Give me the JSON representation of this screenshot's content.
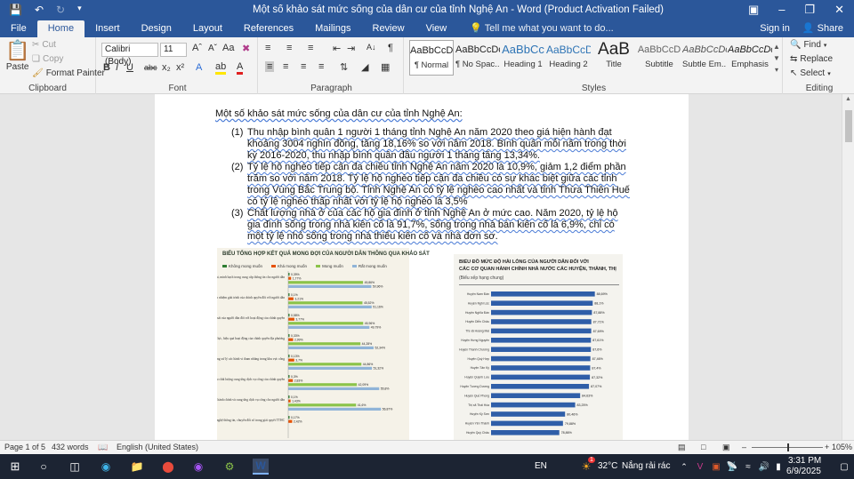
{
  "titlebar": {
    "title": "Một số khảo sát mức sống của dân cư của tỉnh Nghệ An - Word (Product Activation Failed)",
    "save_icon": "save-icon",
    "undo_icon": "undo-icon",
    "redo_icon": "redo-icon"
  },
  "tabs": [
    "File",
    "Home",
    "Insert",
    "Design",
    "Layout",
    "References",
    "Mailings",
    "Review",
    "View"
  ],
  "active_tab": "Home",
  "tellme": "Tell me what you want to do...",
  "signin": "Sign in",
  "share": "Share",
  "clipboard": {
    "paste": "Paste",
    "cut": "Cut",
    "copy": "Copy",
    "format_painter": "Format Painter",
    "label": "Clipboard"
  },
  "font": {
    "name": "Calibri (Body)",
    "size": "11",
    "label": "Font"
  },
  "paragraph": {
    "label": "Paragraph"
  },
  "styles": {
    "label": "Styles",
    "items": [
      {
        "sample": "AaBbCcDc",
        "name": "¶ Normal"
      },
      {
        "sample": "AaBbCcDc",
        "name": "¶ No Spac..."
      },
      {
        "sample": "AaBbCc",
        "name": "Heading 1"
      },
      {
        "sample": "AaBbCcD",
        "name": "Heading 2"
      },
      {
        "sample": "AaB",
        "name": "Title"
      },
      {
        "sample": "AaBbCcD",
        "name": "Subtitle"
      },
      {
        "sample": "AaBbCcDc",
        "name": "Subtle Em..."
      },
      {
        "sample": "AaBbCcDc",
        "name": "Emphasis"
      }
    ]
  },
  "editing": {
    "find": "Find",
    "replace": "Replace",
    "select": "Select",
    "label": "Editing"
  },
  "document": {
    "heading": "Một số khảo sát mức sống của dân cư của tỉnh Nghệ An:",
    "items": [
      {
        "num": "(1)",
        "text": "Thu nhập bình quân 1 người 1 tháng tỉnh Nghệ An năm 2020 theo giá hiện hành đạt khoảng 3004 nghìn đồng, tăng 18,16% so với năm 2018. Bình quân mỗi năm trong thời kỳ 2016-2020, thu nhập bình quân đầu người 1 tháng tăng 13,34%."
      },
      {
        "num": "(2)",
        "text": "Tỷ lệ hộ nghèo tiếp cận đa chiều tỉnh Nghệ An năm 2020 là 10,9%, giảm 1,2 điểm phần trăm so với năm 2018. Tỷ lệ hộ nghèo tiếp cận đa chiều có sự khác biệt giữa các tỉnh trong Vùng Bắc Trung bộ. Tỉnh Nghệ An có tỷ lệ nghèo cao nhất và tỉnh Thừa Thiên Huế có tỷ lệ nghèo thấp nhất với tỷ lệ hộ nghèo là 3,5%"
      },
      {
        "num": "(3)",
        "text": "Chất lượng nhà ở của các hộ gia đình ở tỉnh Nghệ An ở mức cao. Năm 2020, tỷ lệ hộ gia đình sống trong nhà kiên cố là 91,7%, sống trong nhà bán kiên cố là 6,9%, chỉ có một tỷ lệ nhỏ sống trong nhà thiếu kiên cố và nhà đơn sơ."
      }
    ]
  },
  "infographic_left": {
    "title": "BIỂU TỔNG HỢP KẾT QUẢ MONG ĐỢI CỦA NGƯỜI DÂN THÔNG QUA KHẢO SÁT",
    "legend": [
      "Không mong muốn",
      "Khá mong muốn",
      "Mong muốn",
      "Rất mong muốn"
    ],
    "legend_colors": [
      "#2e7d32",
      "#e65100",
      "#8bc34a",
      "#90b4d8"
    ],
    "rows": [
      {
        "label": "Nâng cao tính công khai, minh bạch trong cung cấp thông tin cho người dân",
        "values": [
          "0,39%",
          "1,77%",
          "45,86%",
          "50,96%"
        ]
      },
      {
        "label": "Tăng cường trách nhiệm giải trình của chính quyền đối với người dân",
        "values": [
          "0,1%",
          "3,21%",
          "45,52%",
          "51,16%"
        ]
      },
      {
        "label": "Hỗ công các cơ hội tham gia giám sát của người dân đối với hoạt động của chính quyền",
        "values": [
          "0,58%",
          "3,77%",
          "45,96%",
          "49,79%"
        ]
      },
      {
        "label": "Nâng cao hiệu lực, hiệu quả hoạt động của chính quyền địa phương",
        "values": [
          "0,33%",
          "2,99%",
          "44,28%",
          "52,34%"
        ]
      },
      {
        "label": "Tăng cường xử lý các hành vi tham nhũng trong khu vực công",
        "values": [
          "0,13%",
          "3,7%",
          "44,86%",
          "51,32%"
        ]
      },
      {
        "label": "Tăng cường nâng cao chất lượng cung ứng dịch vụ công của chính quyền",
        "values": [
          "0,3%",
          "2,83%",
          "42,09%",
          "55,8%"
        ]
      },
      {
        "label": "Tăng cường hỗ trợ, thủ tục hành chính và cung ứng dịch vụ công cho người dân",
        "values": [
          "0,1%",
          "1,43%",
          "41,6%",
          "56,87%"
        ]
      },
      {
        "label": "Tăng cường ứng dụng công nghệ thông tin, chuyển đổi số trong giải quyết TTHC",
        "values": [
          "0,17%",
          "2,42%",
          "",
          ""
        ]
      }
    ]
  },
  "infographic_right": {
    "title_line1": "BIỂU ĐỒ MỨC ĐỘ HÀI LÒNG CỦA NGƯỜI DÂN ĐỐI VỚI",
    "title_line2": "CÁC CƠ QUAN HÀNH CHÍNH NHÀ NƯỚC CÁC HUYỆN, THÀNH, THỊ",
    "subtitle": "(Biểu xếp hạng chung)",
    "bar_color": "#2f5ea8",
    "rows": [
      {
        "label": "Huyện Nam Đàn",
        "value": 88.69,
        "text": "88,69%"
      },
      {
        "label": "Huyện Nghi Lộc",
        "value": 88.1,
        "text": "88,1%"
      },
      {
        "label": "Huyện Nghĩa Đàn",
        "value": 87.88,
        "text": "87,88%"
      },
      {
        "label": "Huyện Diễn Châu",
        "value": 87.71,
        "text": "87,71%"
      },
      {
        "label": "Thị xã Hoàng Mai",
        "value": 87.69,
        "text": "87,69%"
      },
      {
        "label": "Huyện Hưng Nguyên",
        "value": 87.61,
        "text": "87,61%"
      },
      {
        "label": "Huyện Thanh Chương",
        "value": 87.6,
        "text": "87,6%"
      },
      {
        "label": "Huyện Quỳ Hợp",
        "value": 87.46,
        "text": "87,46%"
      },
      {
        "label": "Huyện Tân Kỳ",
        "value": 87.4,
        "text": "87,4%"
      },
      {
        "label": "Huyện Quỳnh Lưu",
        "value": 87.32,
        "text": "87,32%"
      },
      {
        "label": "Huyện Tương Dương",
        "value": 87.07,
        "text": "87,07%"
      },
      {
        "label": "Huyện Quế Phong",
        "value": 84.63,
        "text": "84,63%"
      },
      {
        "label": "Thị xã Thái Hòa",
        "value": 83.25,
        "text": "83,25%"
      },
      {
        "label": "Huyện Kỳ Sơn",
        "value": 80.46,
        "text": "80,46%"
      },
      {
        "label": "Huyện Yên Thành",
        "value": 79.88,
        "text": "79,88%"
      },
      {
        "label": "Huyện Quỳ Châu",
        "value": 78.86,
        "text": "78,86%"
      }
    ]
  },
  "statusbar": {
    "page": "Page 1 of 5",
    "words": "432 words",
    "language": "English (United States)",
    "zoom": "105%"
  },
  "taskbar": {
    "lang": "EN",
    "weather_badge": "1",
    "temperature": "32°C",
    "weather": "Nắng rải rác",
    "time": "3:31 PM",
    "date": "6/9/2025"
  }
}
